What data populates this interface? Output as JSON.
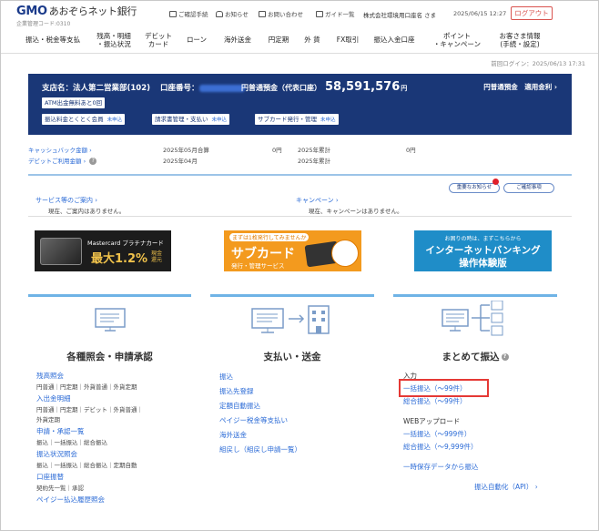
{
  "header": {
    "logo_gmo": "GMO",
    "logo_bank": "あおぞらネット銀行",
    "branch_code": "企業管理コード:0310",
    "util": {
      "procedures": "ご確認手続",
      "notices": "お知らせ",
      "contact": "お問い合わせ",
      "guide": "ガイド一覧"
    },
    "user": "株式会社環境用口座名 さま",
    "datetime": "2025/06/15 12:27",
    "logout": "ログアウト"
  },
  "nav": {
    "items": [
      {
        "label": "振込・税金等支払"
      },
      {
        "label": "残高・明細\n・振込状況"
      },
      {
        "label": "デビット\nカード"
      },
      {
        "label": "ローン"
      },
      {
        "label": "海外送金"
      },
      {
        "label": "円定期"
      },
      {
        "label": "外 貨"
      },
      {
        "label": "FX取引"
      },
      {
        "label": "振込入金口座"
      },
      {
        "label": "ポイント\n・キャンペーン"
      },
      {
        "label": "お客さま情報\n(手続・設定)"
      }
    ]
  },
  "last_login": "前回ログイン：2025/06/13 17:31",
  "account": {
    "branch": "支店名：法人第二営業部(102)",
    "number_label": "口座番号：",
    "balance_label": "円普通預金（代表口座）",
    "balance": "58,591,576",
    "yen": "円",
    "rate_label": "円普通預金　適用金利",
    "atm": "ATM出金無料あと0回",
    "chips": {
      "transfer_fee": "振込料金とくとく会員",
      "billing": "請求書管理・支払い",
      "subcard": "サブカード発行・管理",
      "more": "未申込"
    }
  },
  "cashback": {
    "link_cashback": "キャッシュバック金額",
    "link_debit": "デビットご利用金額",
    "month_total_label": "2025年05月合算",
    "month_total_value": "0円",
    "year_total_label": "2025年累計",
    "year_total_value": "0円",
    "month2_label": "2025年04月",
    "year2_label": "2025年累計"
  },
  "notices": {
    "pill_important": "重要なお知らせ",
    "pill_confirm": "ご確認事項",
    "services_link": "サービス等のご案内",
    "services_text": "現在、ご案内はありません。",
    "campaign_link": "キャンペーン",
    "campaign_text": "現在、キャンペーンはありません。"
  },
  "banners": {
    "card_brand": "Mastercard プラチナカード",
    "card_rate": "最大1.2%",
    "card_rate_suffix": "現金還元",
    "subcard_top": "まずは1枚発行してみませんか",
    "subcard_title": "サブカード",
    "subcard_sub": "発行・管理サービス",
    "ib_top": "お困りの時は、まずこちらから",
    "ib_title": "インターネットバンキング",
    "ib_sub": "操作体験版"
  },
  "panels": {
    "inquiry": {
      "title": "各種照会・申請承認",
      "groups": [
        {
          "head": "残高照会",
          "sub": "円普通｜円定期｜外貨普通｜外貨定期"
        },
        {
          "head": "入出金明細",
          "sub": "円普通｜円定期｜デビット｜外貨普通｜",
          "sub2": "外貨定期"
        },
        {
          "head": "申請・承認一覧",
          "sub": "振込｜一括振込｜総合振込"
        },
        {
          "head": "振込状況照会",
          "sub": "振込｜一括振込｜総合振込｜定期自動"
        },
        {
          "head": "口座振替",
          "sub": "契約先一覧｜承認"
        },
        {
          "head": "ペイジー払込履歴照会"
        }
      ]
    },
    "payment": {
      "title": "支払い・送金",
      "links": [
        "振込",
        "振込先登録",
        "定額自動振込",
        "ペイジー税金等支払い",
        "海外送金",
        "組戻し（組戻し申請一覧）"
      ]
    },
    "bulk": {
      "title": "まとめて振込",
      "input_label": "入力",
      "input_links": [
        "一括振込（〜99件）",
        "総合振込（〜99件）"
      ],
      "web_label": "WEBアップロード",
      "web_links": [
        "一括振込（〜999件）",
        "総合振込（〜9,999件）"
      ],
      "saved_link": "一時保存データから振込",
      "auto_link": "振込自動化（API）"
    }
  }
}
